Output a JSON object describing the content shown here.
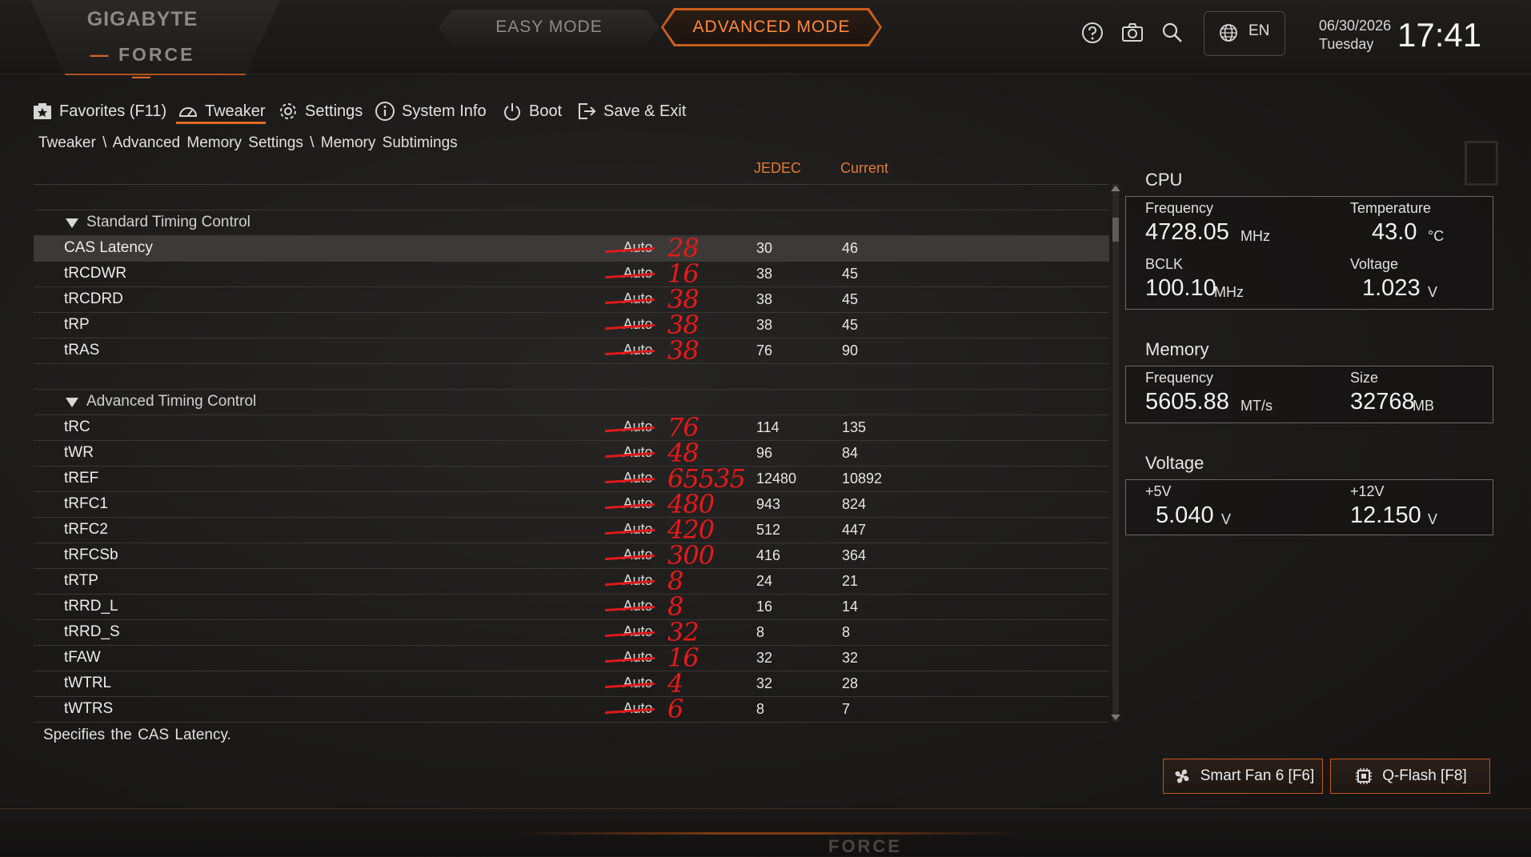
{
  "brand": {
    "logo": "GIGABYTE",
    "sub": "FORCE",
    "footer": "FORCE"
  },
  "modes": {
    "easy": "EASY MODE",
    "advanced": "ADVANCED MODE"
  },
  "topbar": {
    "icons": [
      "help-icon",
      "camera-icon",
      "search-icon"
    ],
    "language": "EN",
    "date": "06/30/2026",
    "day": "Tuesday",
    "time": "17:41"
  },
  "nav": {
    "favorites": "Favorites (F11)",
    "tweaker": "Tweaker",
    "settings": "Settings",
    "system_info": "System Info",
    "boot": "Boot",
    "save_exit": "Save & Exit"
  },
  "breadcrumb": "Tweaker \\ Advanced Memory Settings \\ Memory Subtimings",
  "columns": {
    "jedec": "JEDEC",
    "current": "Current"
  },
  "sections": {
    "standard": "Standard Timing Control",
    "advanced": "Advanced Timing Control"
  },
  "standard_rows": [
    {
      "name": "CAS Latency",
      "value": "Auto",
      "note": "28",
      "jedec": "30",
      "current": "46"
    },
    {
      "name": "tRCDWR",
      "value": "Auto",
      "note": "16",
      "jedec": "38",
      "current": "45"
    },
    {
      "name": "tRCDRD",
      "value": "Auto",
      "note": "38",
      "jedec": "38",
      "current": "45"
    },
    {
      "name": "tRP",
      "value": "Auto",
      "note": "38",
      "jedec": "38",
      "current": "45"
    },
    {
      "name": "tRAS",
      "value": "Auto",
      "note": "38",
      "jedec": "76",
      "current": "90"
    }
  ],
  "advanced_rows": [
    {
      "name": "tRC",
      "value": "Auto",
      "note": "76",
      "jedec": "114",
      "current": "135"
    },
    {
      "name": "tWR",
      "value": "Auto",
      "note": "48",
      "jedec": "96",
      "current": "84"
    },
    {
      "name": "tREF",
      "value": "Auto",
      "note": "65535",
      "jedec": "12480",
      "current": "10892"
    },
    {
      "name": "tRFC1",
      "value": "Auto",
      "note": "480",
      "jedec": "943",
      "current": "824"
    },
    {
      "name": "tRFC2",
      "value": "Auto",
      "note": "420",
      "jedec": "512",
      "current": "447"
    },
    {
      "name": "tRFCSb",
      "value": "Auto",
      "note": "300",
      "jedec": "416",
      "current": "364"
    },
    {
      "name": "tRTP",
      "value": "Auto",
      "note": "8",
      "jedec": "24",
      "current": "21"
    },
    {
      "name": "tRRD_L",
      "value": "Auto",
      "note": "8",
      "jedec": "16",
      "current": "14"
    },
    {
      "name": "tRRD_S",
      "value": "Auto",
      "note": "32",
      "jedec": "8",
      "current": "8"
    },
    {
      "name": "tFAW",
      "value": "Auto",
      "note": "16",
      "jedec": "32",
      "current": "32"
    },
    {
      "name": "tWTRL",
      "value": "Auto",
      "note": "4",
      "jedec": "32",
      "current": "28"
    },
    {
      "name": "tWTRS",
      "value": "Auto",
      "note": "6",
      "jedec": "8",
      "current": "7"
    }
  ],
  "help_text": "Specifies the CAS Latency.",
  "cpu": {
    "title": "CPU",
    "frequency_label": "Frequency",
    "frequency": "4728.05",
    "frequency_unit": "MHz",
    "temperature_label": "Temperature",
    "temperature": "43.0",
    "temperature_unit": "°C",
    "bclk_label": "BCLK",
    "bclk": "100.10",
    "bclk_unit": "MHz",
    "voltage_label": "Voltage",
    "voltage": "1.023",
    "voltage_unit": "V"
  },
  "memory": {
    "title": "Memory",
    "frequency_label": "Frequency",
    "frequency": "5605.88",
    "frequency_unit": "MT/s",
    "size_label": "Size",
    "size": "32768",
    "size_unit": "MB"
  },
  "voltage": {
    "title": "Voltage",
    "v5_label": "+5V",
    "v5": "5.040",
    "v5_unit": "V",
    "v12_label": "+12V",
    "v12": "12.150",
    "v12_unit": "V"
  },
  "buttons": {
    "smart_fan": "Smart Fan 6 [F6]",
    "qflash": "Q-Flash [F8]"
  },
  "colors": {
    "accent": "#e06a24",
    "handwriting": "#e51a1a",
    "background": "#1b1a19"
  }
}
